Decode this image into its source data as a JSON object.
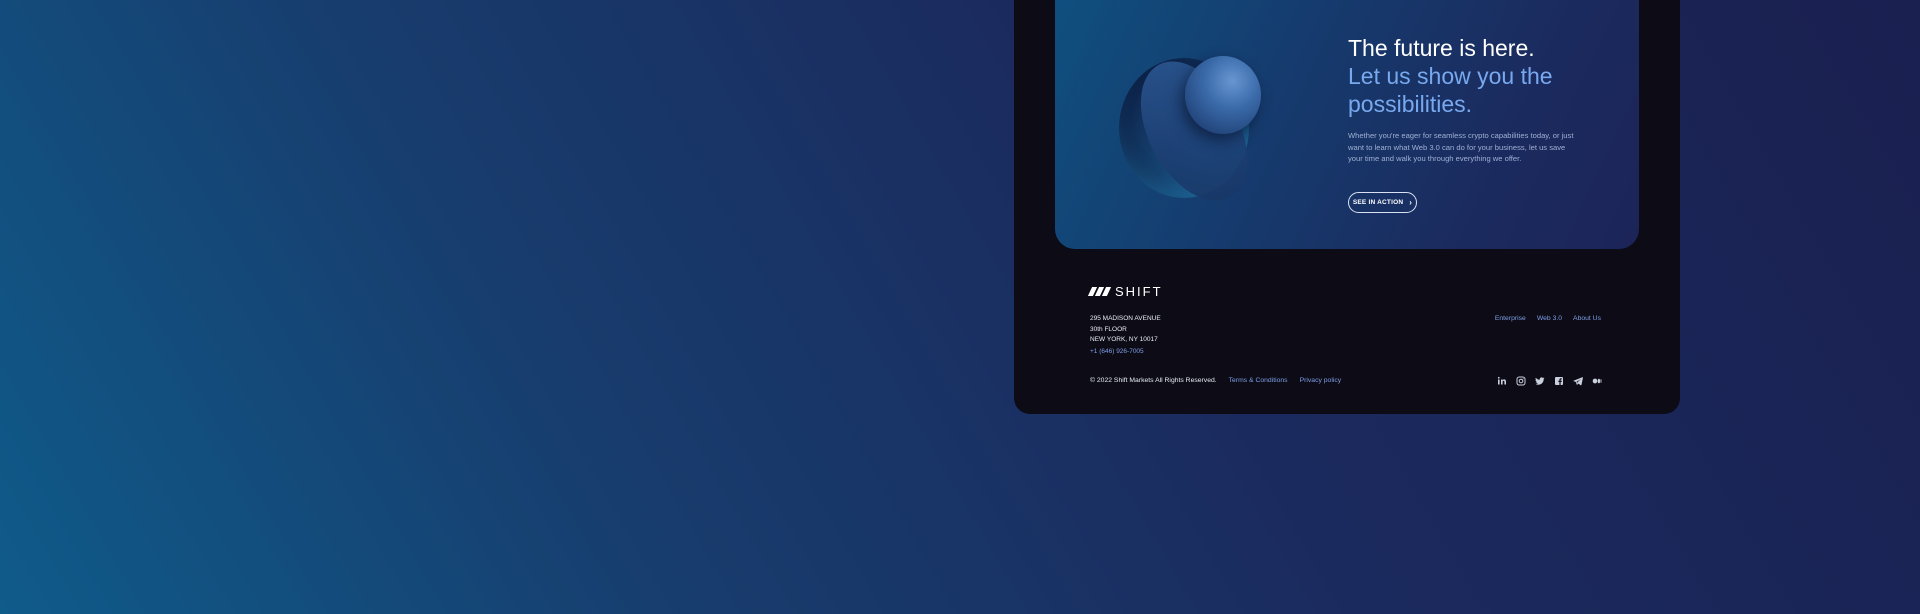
{
  "cta": {
    "title_line1": "The future is here.",
    "title_line2": "Let us show you the possibilities.",
    "body": "Whether you're eager for seamless crypto capabilities today, or just want to learn what Web 3.0 can do for your business, let us save your time and walk you through everything we offer.",
    "button_label": "SEE IN ACTION",
    "button_icon": "chevron-right-icon"
  },
  "footer": {
    "logo_text": "SHIFT",
    "address_line1": "295 MADISON AVENUE",
    "address_line2": "30th FLOOR",
    "address_line3": "NEW YORK, NY 10017",
    "phone": "+1 (646) 926-7005",
    "nav": [
      {
        "label": "Enterprise"
      },
      {
        "label": "Web 3.0"
      },
      {
        "label": "About Us"
      }
    ],
    "copyright": "© 2022 Shift Markets All Rights Reserved.",
    "legal": [
      {
        "label": "Terms & Conditions"
      },
      {
        "label": "Privacy policy"
      }
    ],
    "social_icons": [
      "linkedin-icon",
      "instagram-icon",
      "twitter-icon",
      "facebook-icon",
      "telegram-icon",
      "medium-icon"
    ]
  },
  "colors": {
    "accent": "#78a9ee",
    "link": "#7f9fe6",
    "panel": "#0c0b16"
  }
}
